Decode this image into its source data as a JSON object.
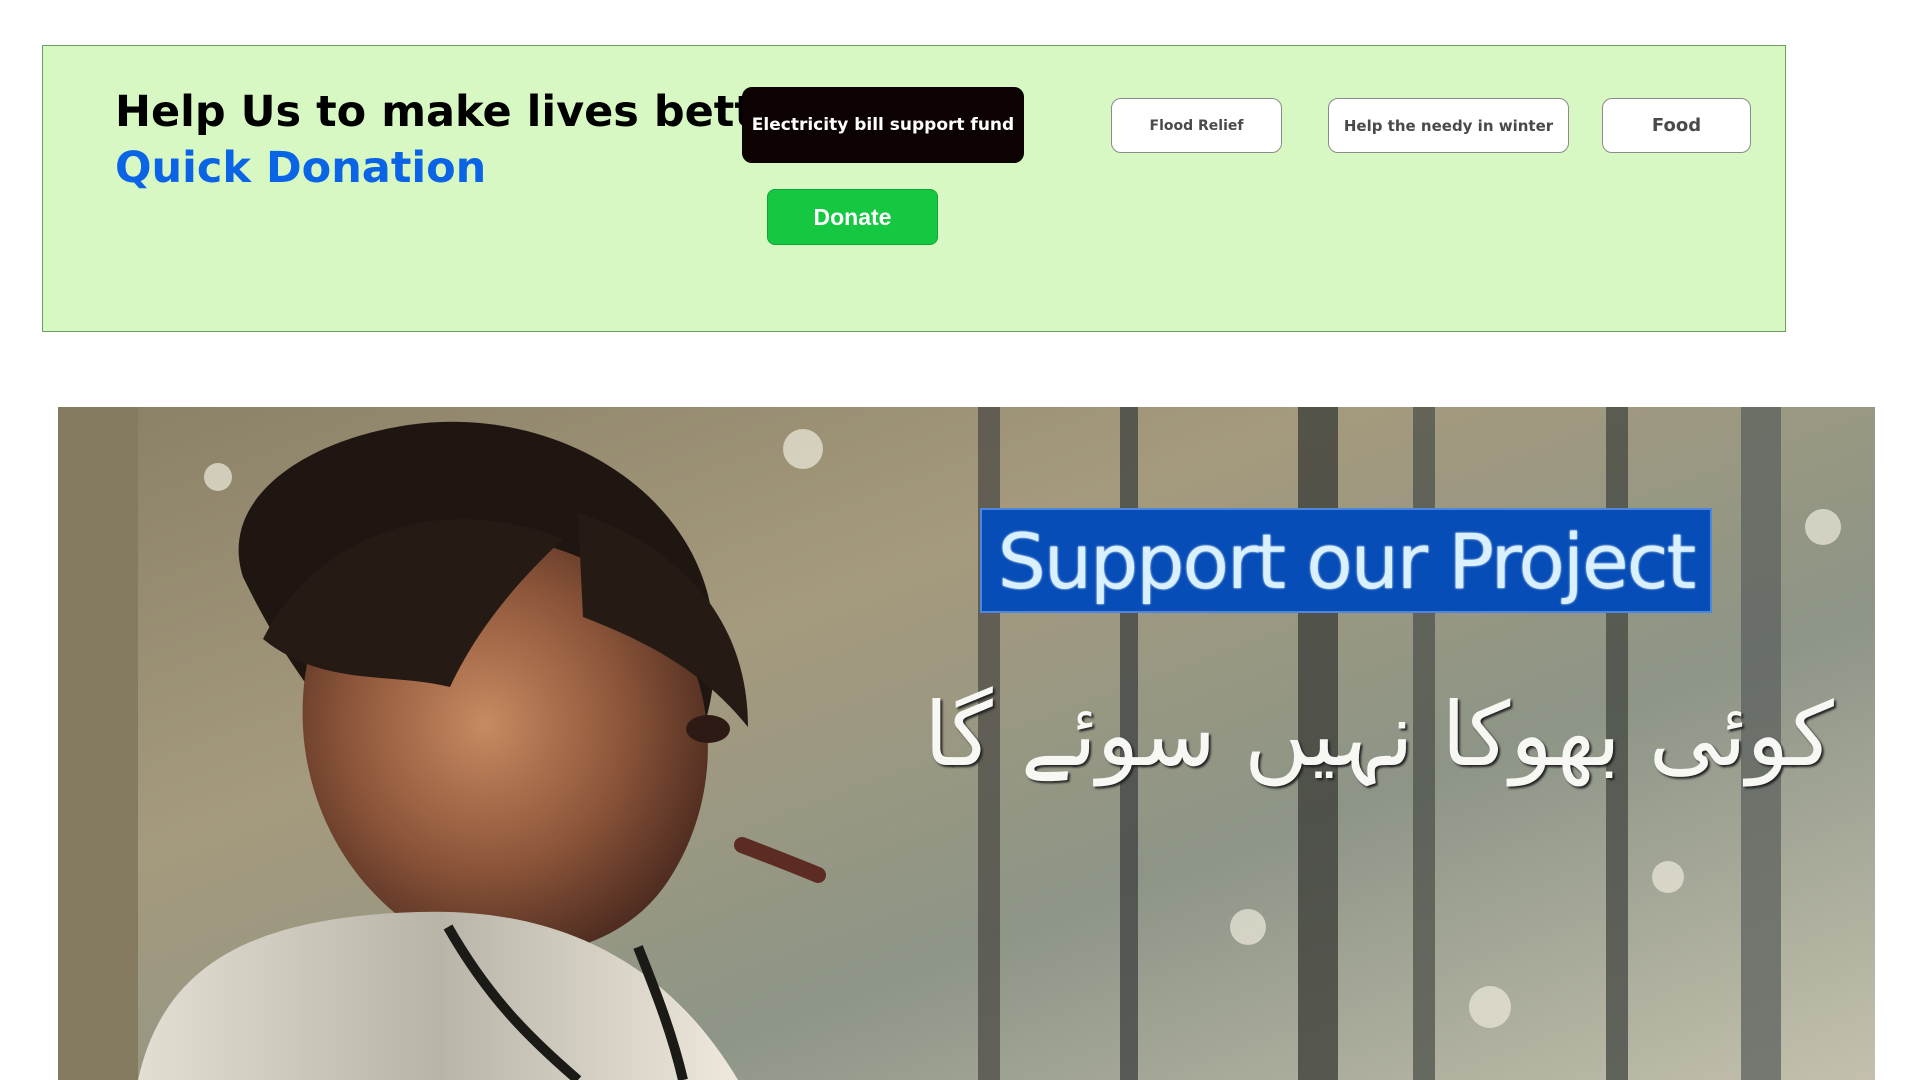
{
  "quick_donation": {
    "heading": "Help Us to make lives better",
    "subheading": "Quick Donation",
    "options": [
      {
        "label": "Electricity bill support fund",
        "selected": true
      },
      {
        "label": "Flood Relief",
        "selected": false
      },
      {
        "label": "Help the needy in winter",
        "selected": false
      },
      {
        "label": "Food",
        "selected": false
      }
    ],
    "donate_label": "Donate"
  },
  "hero": {
    "banner_text": "Support our Project",
    "urdu_text": "کوئی بھوکا نہیں سوئے گا"
  },
  "colors": {
    "panel_background": "#d7f8c2",
    "heading_accent": "#0b63e5",
    "donate_button": "#16c742",
    "selected_option": "#0d0202",
    "banner_background": "#064db8"
  }
}
